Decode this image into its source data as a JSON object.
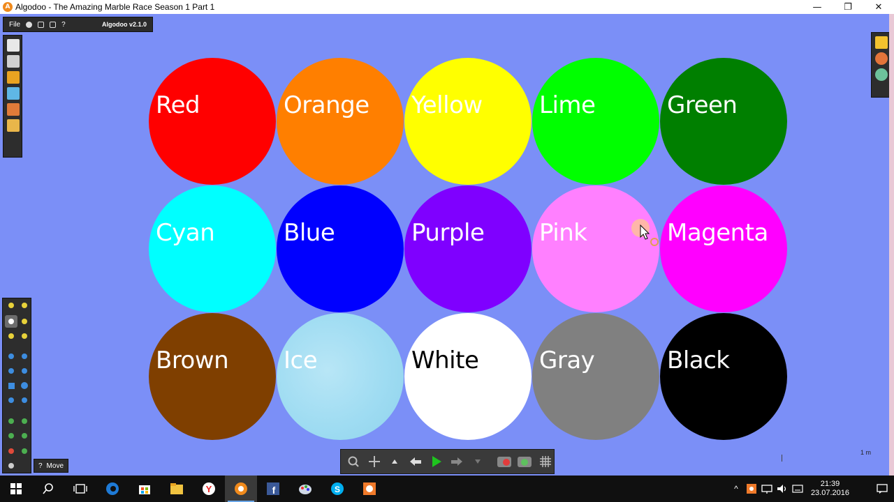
{
  "window": {
    "title": "Algodoo - The Amazing Marble Race Season 1 Part 1",
    "app_icon_letter": "A",
    "minimize": "—",
    "restore": "❐",
    "close": "✕"
  },
  "menubar": {
    "file_label": "File",
    "help_label": "?",
    "version": "Algodoo v2.1.0"
  },
  "marbles": [
    {
      "label": "Red",
      "color": "#ff0000"
    },
    {
      "label": "Orange",
      "color": "#ff7f00"
    },
    {
      "label": "Yellow",
      "color": "#ffff00"
    },
    {
      "label": "Lime",
      "color": "#00ff00"
    },
    {
      "label": "Green",
      "color": "#007f00"
    },
    {
      "label": "Cyan",
      "color": "#00ffff"
    },
    {
      "label": "Blue",
      "color": "#0000ff"
    },
    {
      "label": "Purple",
      "color": "#7f00ff"
    },
    {
      "label": "Pink",
      "color": "#ff80ff"
    },
    {
      "label": "Magenta",
      "color": "#ff00ff"
    },
    {
      "label": "Brown",
      "color": "#7f3f00"
    },
    {
      "label": "Ice",
      "color": "#9fdcf2"
    },
    {
      "label": "White",
      "color": "#ffffff"
    },
    {
      "label": "Gray",
      "color": "#808080"
    },
    {
      "label": "Black",
      "color": "#000000"
    }
  ],
  "tool_label": {
    "help": "?",
    "name": "Move"
  },
  "scale": "1 m",
  "canvas_color": "#7b8ff7",
  "taskbar": {
    "time": "21:39",
    "date": "23.07.2016"
  }
}
